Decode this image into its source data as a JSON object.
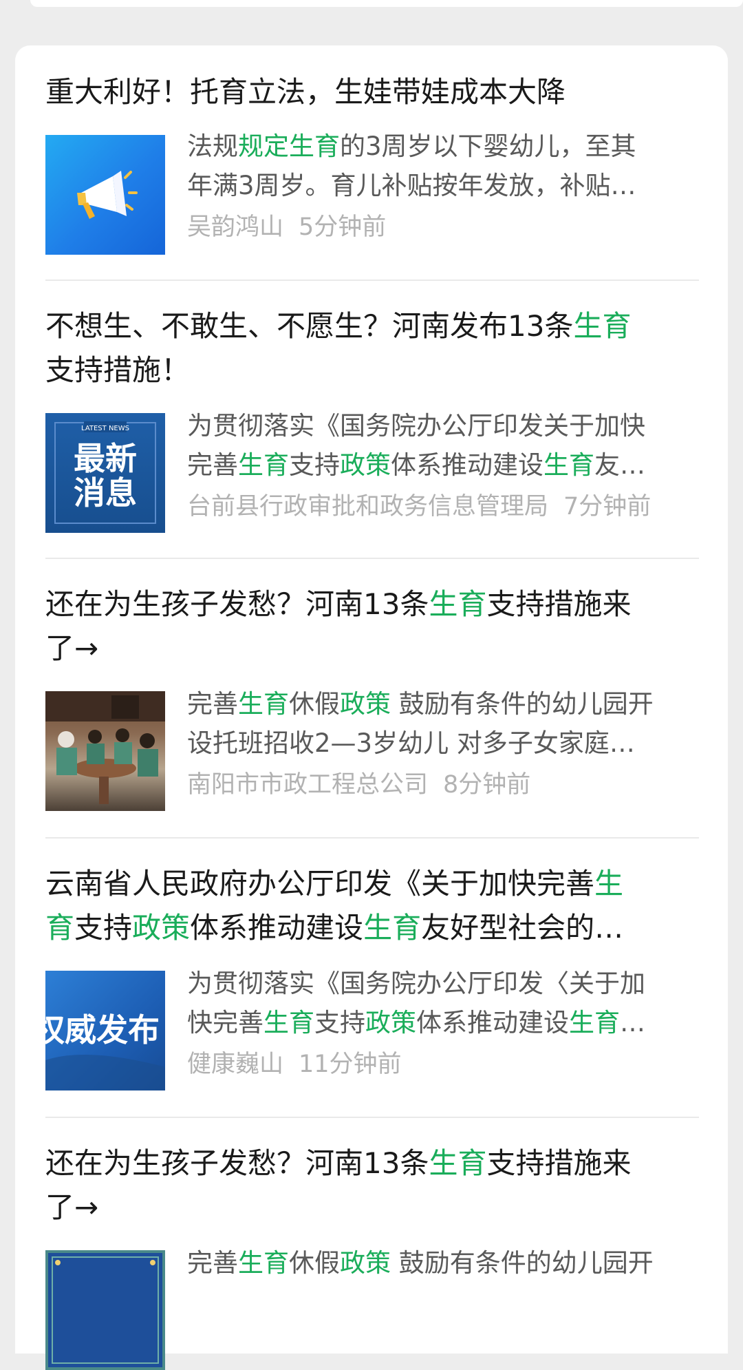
{
  "articles": [
    {
      "title": [
        {
          "t": "重大利好！托育立法，生娃带娃成本大降",
          "hl": false
        }
      ],
      "thumb": {
        "icon": "megaphone-icon"
      },
      "summary": [
        [
          {
            "t": "法规",
            "hl": false
          },
          {
            "t": "规定生育",
            "hl": true
          },
          {
            "t": "的3周岁以下婴幼儿，至其",
            "hl": false
          }
        ],
        [
          {
            "t": "年满3周岁。育儿补贴按年发放，补贴…",
            "hl": false
          }
        ]
      ],
      "source": "吴韵鸿山",
      "time": "5分钟前"
    },
    {
      "title": [
        {
          "t": "不想生、不敢生、不愿生？河南发布13条",
          "hl": false
        },
        {
          "t": "生育",
          "hl": true
        },
        {
          "t": "\n支持措施！",
          "hl": false
        }
      ],
      "thumb": {
        "badge": "LATEST NEWS",
        "text_line1": "最新",
        "text_line2": "消息"
      },
      "summary": [
        [
          {
            "t": "为贯彻落实《国务院办公厅印发关于加快",
            "hl": false
          }
        ],
        [
          {
            "t": "完善",
            "hl": false
          },
          {
            "t": "生育",
            "hl": true
          },
          {
            "t": "支持",
            "hl": false
          },
          {
            "t": "政策",
            "hl": true
          },
          {
            "t": "体系推动建设",
            "hl": false
          },
          {
            "t": "生育",
            "hl": true
          },
          {
            "t": "友…",
            "hl": false
          }
        ]
      ],
      "source": "台前县行政审批和政务信息管理局",
      "time": "7分钟前"
    },
    {
      "title": [
        {
          "t": "还在为生孩子发愁？河南13条",
          "hl": false
        },
        {
          "t": "生育",
          "hl": true
        },
        {
          "t": "支持措施来\n了→",
          "hl": false
        }
      ],
      "thumb": {
        "icon": "photo-children"
      },
      "summary": [
        [
          {
            "t": "完善",
            "hl": false
          },
          {
            "t": "生育",
            "hl": true
          },
          {
            "t": "休假",
            "hl": false
          },
          {
            "t": "政策",
            "hl": true
          },
          {
            "t": " 鼓励有条件的幼儿园开",
            "hl": false
          }
        ],
        [
          {
            "t": "设托班招收2—3岁幼儿 对多子女家庭…",
            "hl": false
          }
        ]
      ],
      "source": "南阳市市政工程总公司",
      "time": "8分钟前"
    },
    {
      "title": [
        {
          "t": "云南省人民政府办公厅印发《关于加快完善",
          "hl": false
        },
        {
          "t": "生\n育",
          "hl": true
        },
        {
          "t": "支持",
          "hl": false
        },
        {
          "t": "政策",
          "hl": true
        },
        {
          "t": "体系推动建设",
          "hl": false
        },
        {
          "t": "生育",
          "hl": true
        },
        {
          "t": "友好型社会的…",
          "hl": false
        }
      ],
      "thumb": {
        "text": "权威发布"
      },
      "summary": [
        [
          {
            "t": "为贯彻落实《国务院办公厅印发〈关于加",
            "hl": false
          }
        ],
        [
          {
            "t": "快完善",
            "hl": false
          },
          {
            "t": "生育",
            "hl": true
          },
          {
            "t": "支持",
            "hl": false
          },
          {
            "t": "政策",
            "hl": true
          },
          {
            "t": "体系推动建设",
            "hl": false
          },
          {
            "t": "生育",
            "hl": true
          },
          {
            "t": "…",
            "hl": false
          }
        ]
      ],
      "source": "健康巍山",
      "time": "11分钟前"
    },
    {
      "title": [
        {
          "t": "还在为生孩子发愁？河南13条",
          "hl": false
        },
        {
          "t": "生育",
          "hl": true
        },
        {
          "t": "支持措施来\n了→",
          "hl": false
        }
      ],
      "thumb": {
        "icon": "framed-image"
      },
      "summary": [
        [
          {
            "t": "完善",
            "hl": false
          },
          {
            "t": "生育",
            "hl": true
          },
          {
            "t": "休假",
            "hl": false
          },
          {
            "t": "政策",
            "hl": true
          },
          {
            "t": " 鼓励有条件的幼儿园开",
            "hl": false
          }
        ]
      ],
      "source": "",
      "time": ""
    }
  ],
  "colors": {
    "highlight": "#1aad5a",
    "title": "#1a1a1a",
    "summary": "#595959",
    "meta": "#b2b2b2"
  }
}
